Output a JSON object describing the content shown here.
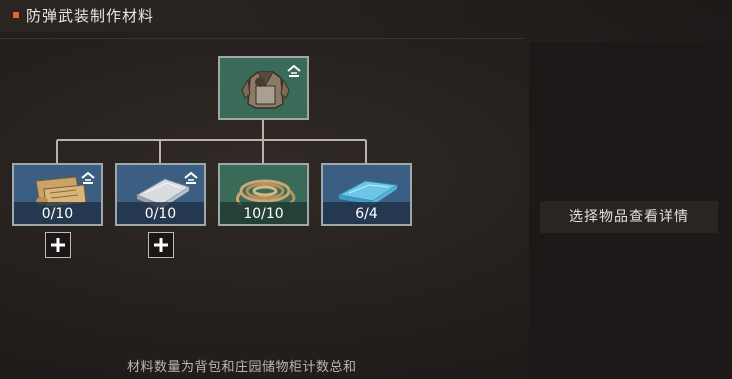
{
  "header": {
    "title": "防弹武装制作材料"
  },
  "product": {
    "name": "防弹武装",
    "icon": "armor-vest-icon",
    "badge_icon": "upgrade-icon"
  },
  "materials": [
    {
      "icon": "scroll-icon",
      "quantity": "0/10",
      "upgradeable": true,
      "has_add_button": true
    },
    {
      "icon": "metal-plate-icon",
      "quantity": "0/10",
      "upgradeable": true,
      "has_add_button": true
    },
    {
      "icon": "rope-icon",
      "quantity": "10/10",
      "upgradeable": false,
      "has_add_button": false
    },
    {
      "icon": "blue-fabric-icon",
      "quantity": "6/4",
      "upgradeable": false,
      "has_add_button": false
    }
  ],
  "detail_panel": {
    "hint": "选择物品查看详情"
  },
  "footnote": "材料数量为背包和庄园储物柜计数总和",
  "colors": {
    "accent": "#e0662a",
    "slot_blue": "#3b5f83",
    "slot_green": "#3a6a58",
    "slot_border": "#9ea7a9"
  }
}
